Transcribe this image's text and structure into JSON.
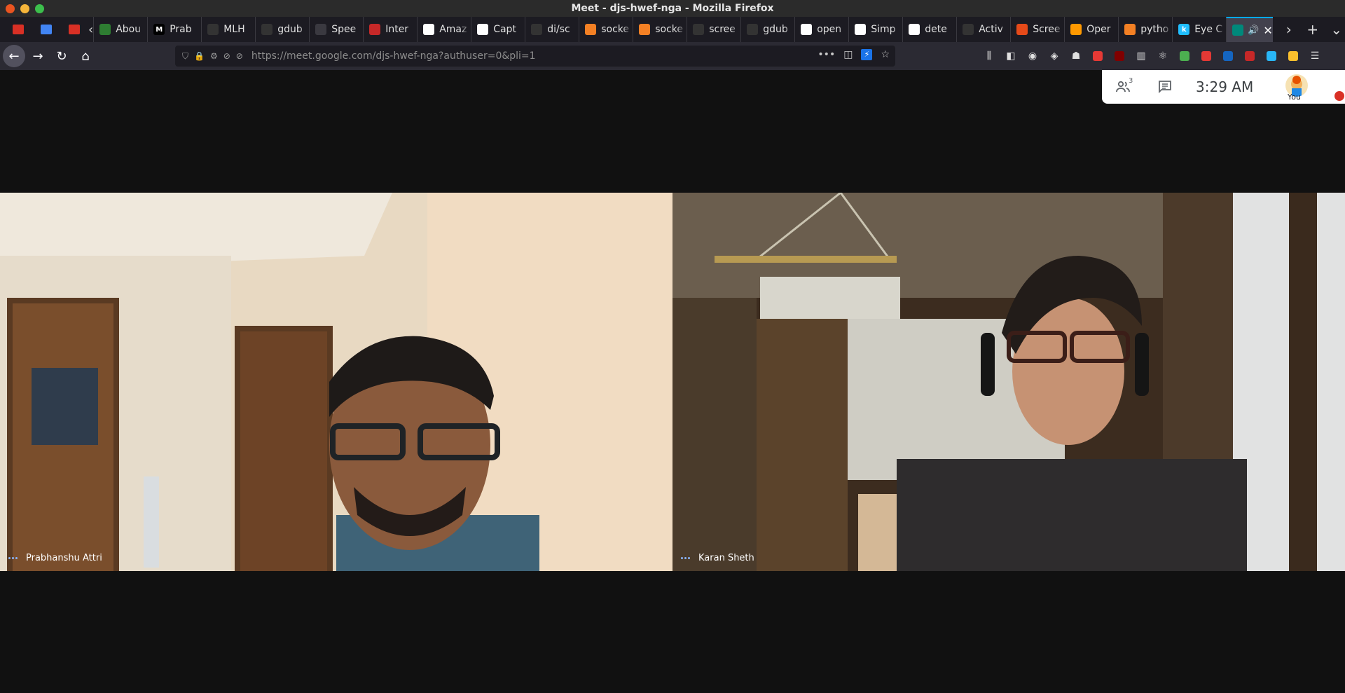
{
  "window": {
    "title": "Meet - djs-hwef-nga - Mozilla Firefox"
  },
  "pinned_tabs": [
    {
      "icon": "gmail-icon",
      "color": "#d93025"
    },
    {
      "icon": "shield-extension-icon",
      "color": "#4285f4"
    },
    {
      "icon": "gmail-icon",
      "color": "#d93025"
    }
  ],
  "tabs": [
    {
      "label": "Abou",
      "icon": "tree-icon",
      "color": "#2e7d32"
    },
    {
      "label": "Prab",
      "icon": "medium-icon",
      "color": "#000000",
      "glyph": "M"
    },
    {
      "label": "MLH",
      "icon": "github-icon",
      "color": "#333333"
    },
    {
      "label": "gdub",
      "icon": "github-icon",
      "color": "#333333"
    },
    {
      "label": "Spee",
      "icon": "speech-icon",
      "color": "#3a3940"
    },
    {
      "label": "Inter",
      "icon": "interview-icon",
      "color": "#c62828"
    },
    {
      "label": "Amaz",
      "icon": "amazon-icon",
      "color": "#ffffff"
    },
    {
      "label": "Capt",
      "icon": "caption-icon",
      "color": "#ffffff"
    },
    {
      "label": "di/sc",
      "icon": "github-icon",
      "color": "#333333"
    },
    {
      "label": "socke",
      "icon": "stackoverflow-icon",
      "color": "#f48024"
    },
    {
      "label": "socke",
      "icon": "stackoverflow-icon",
      "color": "#f48024"
    },
    {
      "label": "scree",
      "icon": "github-icon",
      "color": "#333333"
    },
    {
      "label": "gdub",
      "icon": "github-icon",
      "color": "#333333"
    },
    {
      "label": "open",
      "icon": "google-icon",
      "color": "#ffffff"
    },
    {
      "label": "Simp",
      "icon": "simple-icon",
      "color": "#ffffff"
    },
    {
      "label": "dete",
      "icon": "google-icon",
      "color": "#ffffff"
    },
    {
      "label": "Activ",
      "icon": "github-icon",
      "color": "#333333"
    },
    {
      "label": "Scree",
      "icon": "ask-icon",
      "color": "#e64a19"
    },
    {
      "label": "Oper",
      "icon": "aws-icon",
      "color": "#ff9900"
    },
    {
      "label": "pytho",
      "icon": "python-icon",
      "color": "#f48024"
    },
    {
      "label": "Eye C",
      "icon": "kaggle-icon",
      "color": "#20beff",
      "glyph": "k"
    }
  ],
  "active_tab": {
    "icon": "meet-icon",
    "color": "#00897b"
  },
  "navbar": {
    "url": "https://meet.google.com/djs-hwef-nga?authuser=0&pli=1"
  },
  "extensions": [
    {
      "icon": "library-icon"
    },
    {
      "icon": "sidebar-icon"
    },
    {
      "icon": "account-icon"
    },
    {
      "icon": "extension-a-icon"
    },
    {
      "icon": "ghostery-icon"
    },
    {
      "icon": "screenshot-icon",
      "color": "#e53935"
    },
    {
      "icon": "ublock-icon",
      "color": "#800000",
      "badge": "1"
    },
    {
      "icon": "columns-icon"
    },
    {
      "icon": "react-icon"
    },
    {
      "icon": "colorful-icon",
      "color": "#4caf50"
    },
    {
      "icon": "red-circle-icon",
      "color": "#e53935"
    },
    {
      "icon": "cursor-icon",
      "color": "#1565c0"
    },
    {
      "icon": "red-tool-icon",
      "color": "#c62828"
    },
    {
      "icon": "save-icon",
      "color": "#29b6f6"
    },
    {
      "icon": "yellow-icon",
      "color": "#fbc02d"
    },
    {
      "icon": "menu-icon"
    }
  ],
  "meet": {
    "participant_count": "3",
    "time": "3:29 AM",
    "self_label": "You",
    "participants": [
      {
        "name": "Prabhanshu Attri"
      },
      {
        "name": "Karan Sheth"
      }
    ]
  }
}
